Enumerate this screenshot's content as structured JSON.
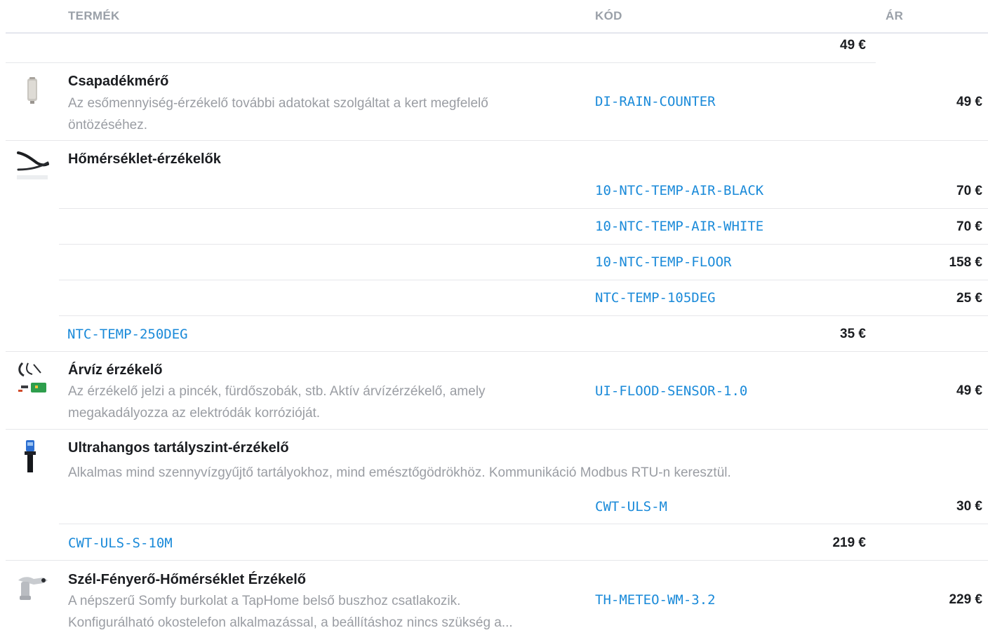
{
  "header": {
    "product": "TERMÉK",
    "code": "KÓD",
    "price": "ÁR"
  },
  "rows": {
    "top_price": "49 €",
    "rain": {
      "name": "Csapadékmérő",
      "desc_1": "Az esőmennyiség-érzékelő további adatokat szolgáltat a kert megfelelő",
      "desc_2": "öntözéséhez.",
      "code": "DI-RAIN-COUNTER",
      "price": "49 €"
    },
    "temp": {
      "name": "Hőmérséklet-érzékelők",
      "variants": [
        {
          "code": "10-NTC-TEMP-AIR-BLACK",
          "price": "70 €"
        },
        {
          "code": "10-NTC-TEMP-AIR-WHITE",
          "price": "70 €"
        },
        {
          "code": "10-NTC-TEMP-FLOOR",
          "price": "158 €"
        },
        {
          "code": "NTC-TEMP-105DEG",
          "price": "25 €"
        },
        {
          "code": "NTC-TEMP-250DEG",
          "price": "35 €"
        }
      ]
    },
    "flood": {
      "name": "Árvíz érzékelő",
      "desc_1": "Az érzékelő jelzi a pincék, fürdőszobák, stb. Aktív árvízérzékelő, amely",
      "desc_2": "megakadályozza az elektródák korrózióját.",
      "code": "UI-FLOOD-SENSOR-1.0",
      "price": "49 €"
    },
    "ultra": {
      "name": "Ultrahangos tartályszint-érzékelő",
      "desc": "Alkalmas mind szennyvízgyűjtő tartályokhoz, mind emésztőgödrökhöz. Kommunikáció Modbus RTU-n keresztül.",
      "variants": [
        {
          "code": "CWT-ULS-M",
          "price": "30 €"
        },
        {
          "code": "CWT-ULS-S-10M",
          "price": "219 €"
        }
      ]
    },
    "meteo": {
      "name": "Szél-Fényerő-Hőmérséklet Érzékelő",
      "desc_1": "A népszerű Somfy burkolat a TapHome belső buszhoz csatlakozik.",
      "desc_2": "Konfigurálható okostelefon alkalmazással, a beállításhoz nincs szükség a...",
      "code": "TH-METEO-WM-3.2",
      "price": "229 €"
    }
  },
  "icons": {
    "rain": "rain-gauge-icon",
    "temp": "temperature-probe-icon",
    "flood": "flood-sensor-icon",
    "ultra": "ultrasonic-sensor-icon",
    "meteo": "weather-station-icon"
  },
  "colors": {
    "link": "#1a8ad9",
    "header": "#9aa0a8",
    "muted": "#9a9da3",
    "text": "#1b1d21"
  }
}
